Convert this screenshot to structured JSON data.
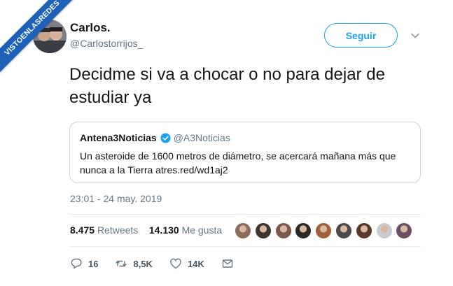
{
  "watermark": "VISTOENLASREDES",
  "user": {
    "name": "Carlos.",
    "handle": "@Carlostorrijos_"
  },
  "follow_label": "Seguir",
  "tweet_text": "Decidme si va a chocar o no para dejar de estudiar ya",
  "quote": {
    "name": "Antena3Noticias",
    "handle": "@A3Noticias",
    "text": "Un asteroide de 1600 metros de diámetro, se acercará mañana más que nunca a la Tierra atres.red/wd1aj2"
  },
  "timestamp": "23:01 - 24 may. 2019",
  "stats": {
    "retweets_count": "8.475",
    "retweets_label": "Retweets",
    "likes_count": "14.130",
    "likes_label": "Me gusta"
  },
  "actions": {
    "replies": "16",
    "retweets": "8,5K",
    "likes": "14K"
  },
  "colors": {
    "accent": "#1da1f2",
    "watermark": "#1d62b8",
    "muted": "#657786"
  },
  "liker_avatar_colors": [
    "#8a6d5a",
    "#3c3530",
    "#7a5a4a",
    "#2a2a2a",
    "#a0603c",
    "#4a4a4a",
    "#5a3a2a",
    "#c8ccd0",
    "#6a5060"
  ]
}
